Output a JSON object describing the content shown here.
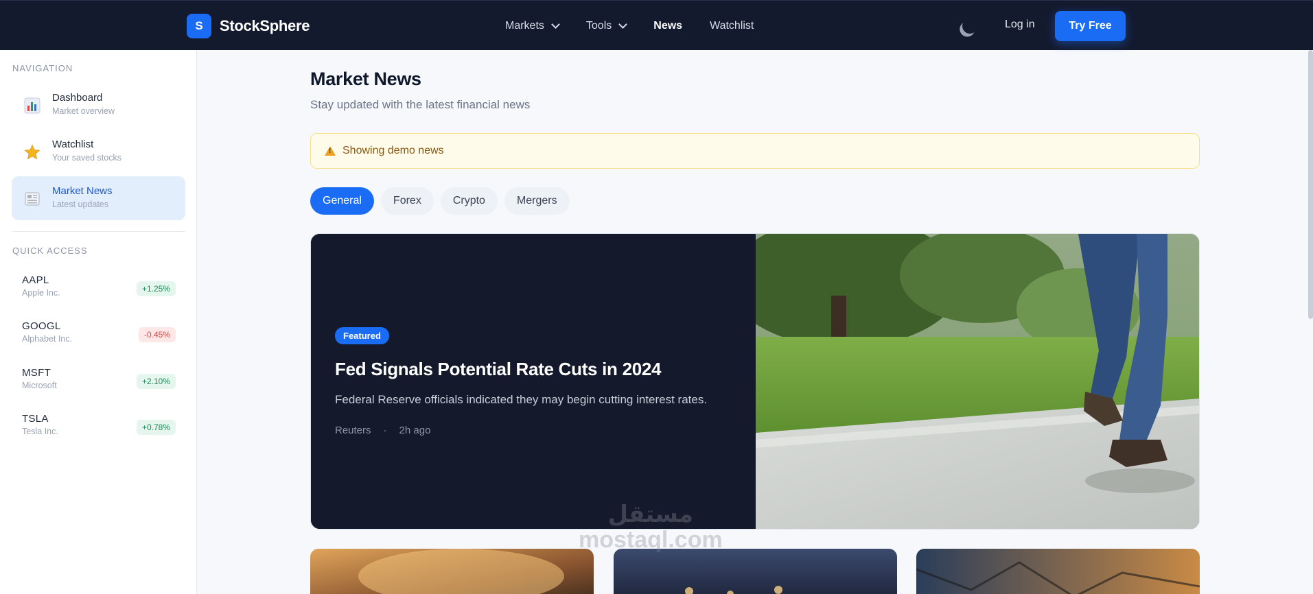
{
  "brand": {
    "logo_letter": "S",
    "name": "StockSphere"
  },
  "topnav": {
    "markets": "Markets",
    "tools": "Tools",
    "news": "News",
    "watchlist": "Watchlist",
    "theme_icon": "moon-icon",
    "login": "Log in",
    "try_free": "Try Free"
  },
  "sidebar": {
    "nav_heading": "NAVIGATION",
    "items": [
      {
        "title": "Dashboard",
        "subtitle": "Market overview",
        "icon": "bar-chart-icon"
      },
      {
        "title": "Watchlist",
        "subtitle": "Your saved stocks",
        "icon": "star-icon"
      },
      {
        "title": "Market News",
        "subtitle": "Latest updates",
        "icon": "newspaper-icon"
      }
    ],
    "quick_heading": "QUICK ACCESS",
    "quick": [
      {
        "symbol": "AAPL",
        "name": "Apple Inc.",
        "change": "+1.25%",
        "direction": "up"
      },
      {
        "symbol": "GOOGL",
        "name": "Alphabet Inc.",
        "change": "-0.45%",
        "direction": "down"
      },
      {
        "symbol": "MSFT",
        "name": "Microsoft",
        "change": "+2.10%",
        "direction": "up"
      },
      {
        "symbol": "TSLA",
        "name": "Tesla Inc.",
        "change": "+0.78%",
        "direction": "up"
      }
    ]
  },
  "main": {
    "title": "Market News",
    "subtitle": "Stay updated with the latest financial news",
    "alert": "Showing demo news",
    "tabs": [
      "General",
      "Forex",
      "Crypto",
      "Mergers"
    ],
    "featured": {
      "badge": "Featured",
      "headline": "Fed Signals Potential Rate Cuts in 2024",
      "summary": "Federal Reserve officials indicated they may begin cutting interest rates.",
      "source": "Reuters",
      "separator": "·",
      "time": "2h ago"
    }
  },
  "watermark": {
    "arabic": "مستقل",
    "latin": "mostaql.com"
  },
  "colors": {
    "accent": "#1a6cf5",
    "navbar": "#141a2e",
    "up": "#1f8a5a",
    "down": "#d94848"
  }
}
